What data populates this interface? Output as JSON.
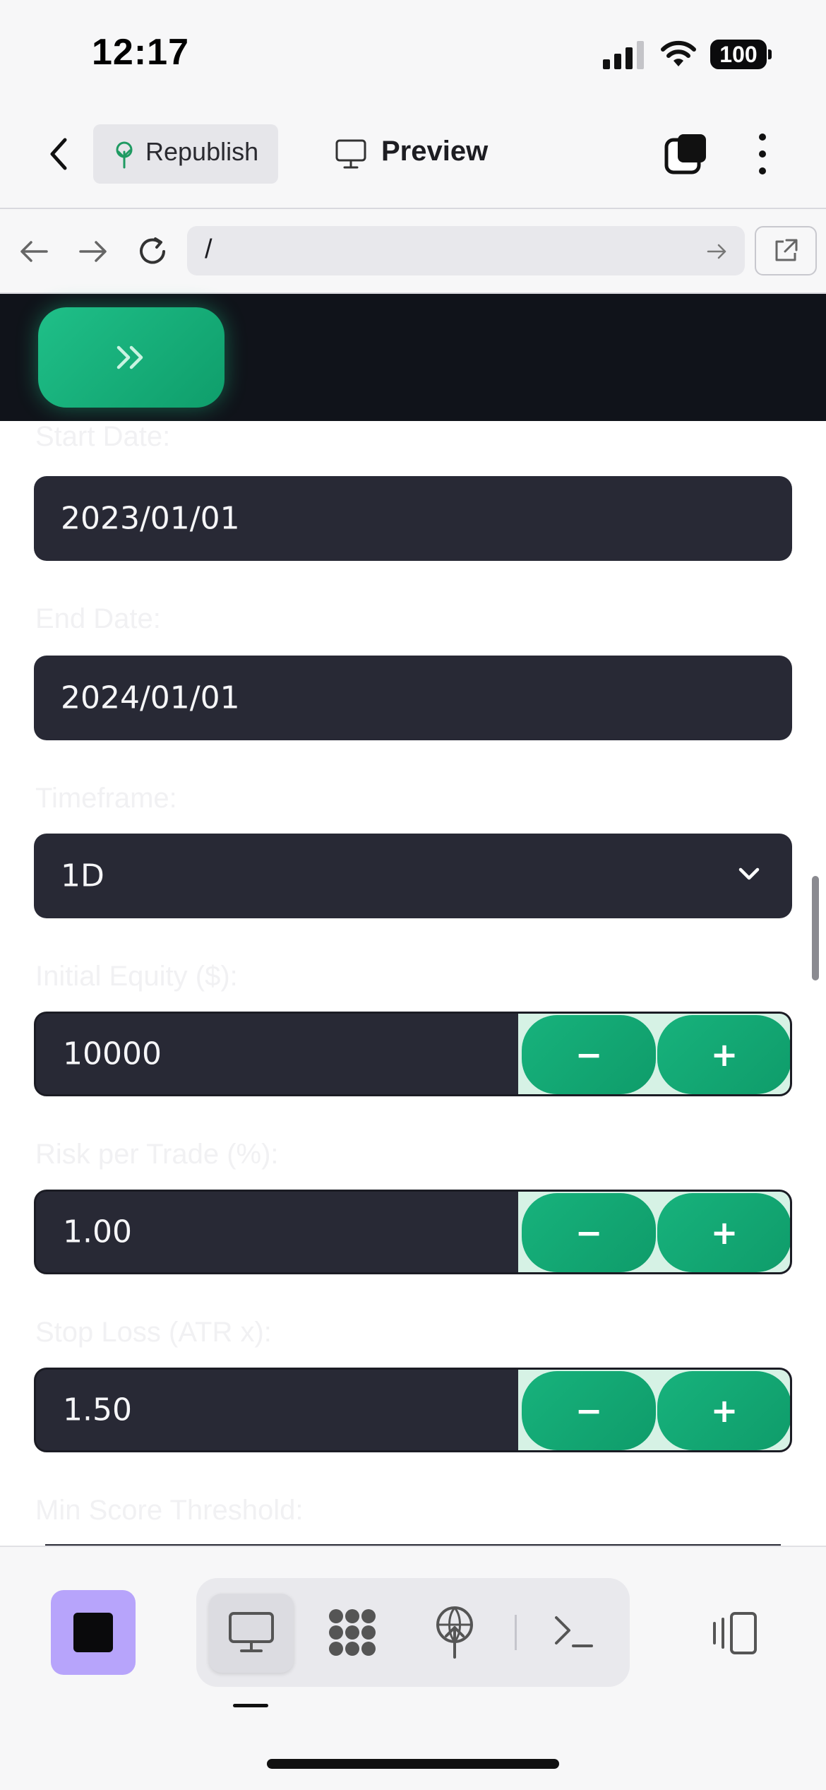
{
  "status_bar": {
    "time": "12:17",
    "battery": "100"
  },
  "header": {
    "republish_label": "Republish",
    "preview_label": "Preview"
  },
  "browser": {
    "url": "/"
  },
  "form": {
    "start_date": {
      "label": "Start Date:",
      "value": "2023/01/01"
    },
    "end_date": {
      "label": "End Date:",
      "value": "2024/01/01"
    },
    "timeframe": {
      "label": "Timeframe:",
      "value": "1D"
    },
    "initial_equity": {
      "label": "Initial Equity ($):",
      "value": "10000"
    },
    "risk_per_trade": {
      "label": "Risk per Trade (%):",
      "value": "1.00"
    },
    "stop_loss": {
      "label": "Stop Loss (ATR x):",
      "value": "1.50"
    },
    "min_score": {
      "label": "Min Score Threshold:"
    },
    "minus_label": "−",
    "plus_label": "+"
  },
  "colors": {
    "accent_green": "#12a875",
    "field_bg": "#282935",
    "dark_bg": "#10131a",
    "stop_button": "#b7a4fb"
  },
  "icons": {
    "back": "chevron-left-icon",
    "republish": "tree-icon",
    "preview": "monitor-icon",
    "tabs": "tabs-icon",
    "more": "more-vertical-icon",
    "nav_back": "arrow-left-icon",
    "nav_forward": "arrow-right-icon",
    "reload": "reload-icon",
    "go": "arrow-right-icon",
    "open_external": "external-link-icon",
    "expand": "double-chevron-right-icon",
    "dropdown": "chevron-down-icon",
    "stop": "stop-icon",
    "desktop": "monitor-icon",
    "workflow": "workflow-icon",
    "deploy": "deploy-icon",
    "shell": "terminal-icon",
    "layout": "split-layout-icon"
  }
}
